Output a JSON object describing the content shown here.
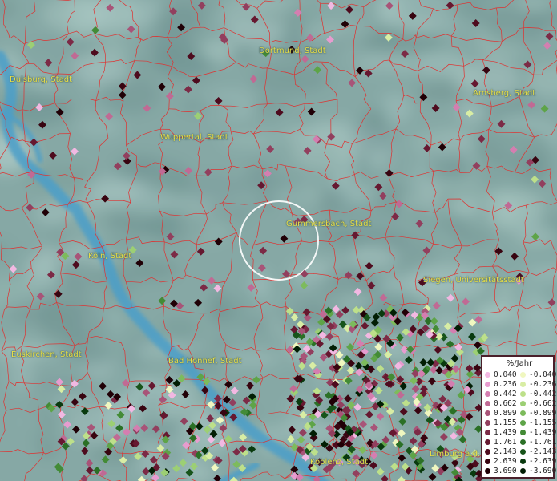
{
  "cities": [
    {
      "id": "dortmund",
      "label": "Dortmund, Stadt"
    },
    {
      "id": "duisburg",
      "label": "Duisburg, Stadt"
    },
    {
      "id": "arnsberg",
      "label": "Arnsberg, Stadt"
    },
    {
      "id": "wuppertal",
      "label": "Wuppertal, Stadt"
    },
    {
      "id": "gummersbach",
      "label": "Gummersbach, Stadt"
    },
    {
      "id": "koeln",
      "label": "Köln, Stadt"
    },
    {
      "id": "siegen",
      "label": "Siegen, Universitätsstadt"
    },
    {
      "id": "euskirchen",
      "label": "Euskirchen, Stadt"
    },
    {
      "id": "badhonnef",
      "label": "Bad Honnef, Stadt"
    },
    {
      "id": "koblenz",
      "label": "Koblenz, Stadt"
    },
    {
      "id": "limburg",
      "label": "Limburg a.d. L"
    }
  ],
  "legend": {
    "title": "%/Jahr",
    "positive": [
      {
        "label": "0.040",
        "color": "#f2b8e2"
      },
      {
        "label": "0.236",
        "color": "#e79ccf"
      },
      {
        "label": "0.442",
        "color": "#d47eb0"
      },
      {
        "label": "0.662",
        "color": "#c06a94"
      },
      {
        "label": "0.899",
        "color": "#a85478"
      },
      {
        "label": "1.155",
        "color": "#923f5e"
      },
      {
        "label": "1.439",
        "color": "#7c2a46"
      },
      {
        "label": "1.761",
        "color": "#661830"
      },
      {
        "label": "2.143",
        "color": "#4e0b1e"
      },
      {
        "label": "2.639",
        "color": "#380410"
      },
      {
        "label": "3.690",
        "color": "#200006"
      }
    ],
    "negative": [
      {
        "label": "-0.040",
        "color": "#f0f7c0"
      },
      {
        "label": "-0.236",
        "color": "#d8eda4"
      },
      {
        "label": "-0.442",
        "color": "#bde08a"
      },
      {
        "label": "-0.662",
        "color": "#9ccf74"
      },
      {
        "label": "-0.899",
        "color": "#7dbb5c"
      },
      {
        "label": "-1.155",
        "color": "#5ea448"
      },
      {
        "label": "-1.439",
        "color": "#438b36"
      },
      {
        "label": "-1.761",
        "color": "#2b7026"
      },
      {
        "label": "-2.143",
        "color": "#17541a"
      },
      {
        "label": "-2.639",
        "color": "#093a0e"
      },
      {
        "label": "-3.690",
        "color": "#021e04"
      }
    ]
  },
  "colors": {
    "water": "#4b9fc9",
    "boundary": "#e0302f",
    "terrain_light": "#a9c7c3",
    "terrain_dark": "#6f9391"
  }
}
